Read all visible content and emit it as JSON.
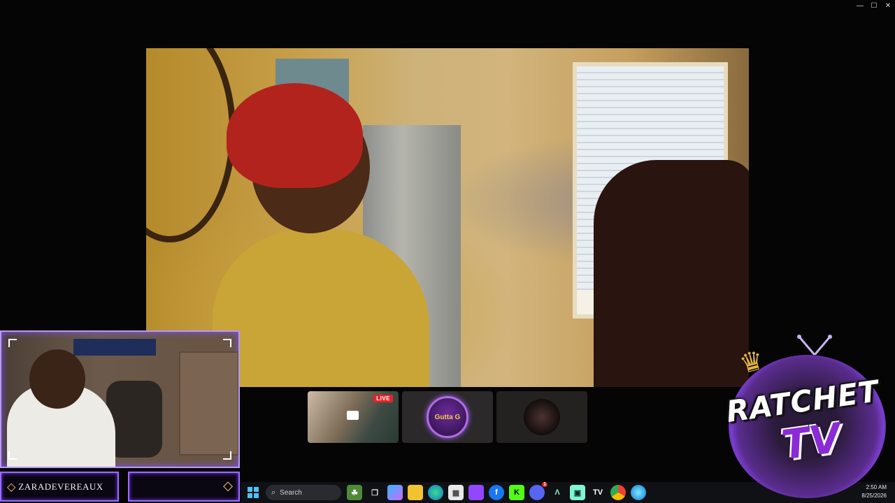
{
  "window": {
    "controls": [
      "—",
      "☐",
      "✕"
    ]
  },
  "stream": {
    "thumbnails": [
      {
        "live_badge": "LIVE"
      },
      {
        "logo_text": "Gutta G"
      },
      {}
    ]
  },
  "webcam": {
    "streamer_name": "ZARADEVEREAUX"
  },
  "overlay_logo": {
    "line1": "RATCHET",
    "line2": "TV"
  },
  "taskbar": {
    "search_placeholder": "Search",
    "icons": [
      "windows-start",
      "search",
      "widgets",
      "task-view",
      "copilot",
      "file-explorer",
      "edge",
      "store",
      "twitch",
      "facebook",
      "kick",
      "discord",
      "arc",
      "streamlabs",
      "tradingview",
      "chrome",
      "edge-secondary"
    ],
    "discord_badge": "1",
    "time": "2:50 AM",
    "date": "8/25/2026"
  },
  "colors": {
    "accent_purple": "#9a6bff",
    "live_red": "#e4242b",
    "gold": "#f2cc6a"
  }
}
